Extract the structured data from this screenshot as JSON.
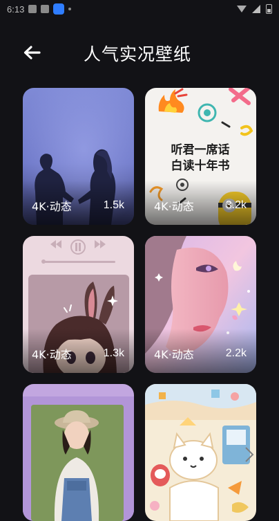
{
  "status_bar": {
    "time": "6:13"
  },
  "header": {
    "title": "人气实况壁纸"
  },
  "cards": [
    {
      "tag": "4K·动态",
      "count": "1.5k"
    },
    {
      "tag": "4K·动态",
      "count": "3.2k",
      "overlay_text_line1": "听君一席话",
      "overlay_text_line2": "白读十年书"
    },
    {
      "tag": "4K·动态",
      "count": "1.3k"
    },
    {
      "tag": "4K·动态",
      "count": "2.2k"
    },
    {
      "tag": "",
      "count": ""
    },
    {
      "tag": "",
      "count": ""
    }
  ],
  "icons": {
    "back": "arrow-left-icon"
  },
  "colors": {
    "background": "#121216",
    "text": "#ffffff"
  }
}
